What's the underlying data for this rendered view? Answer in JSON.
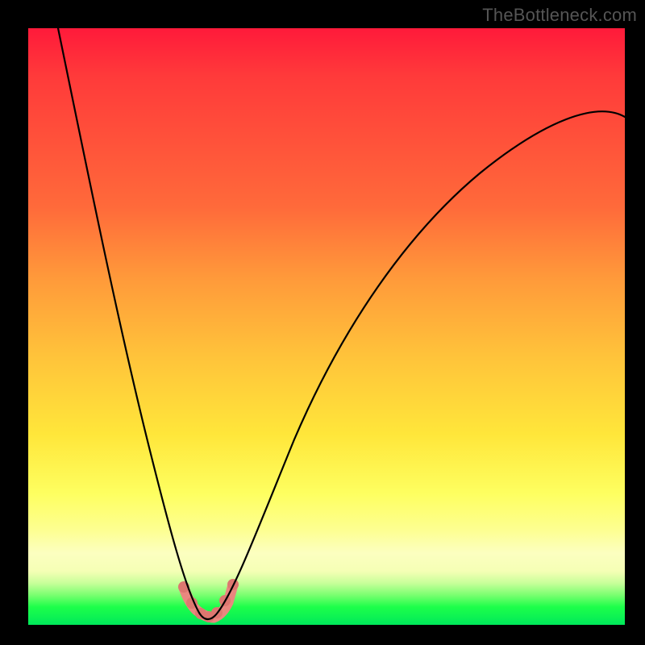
{
  "watermark": "TheBottleneck.com",
  "colors": {
    "frame": "#000000",
    "gradient_top": "#ff1a3a",
    "gradient_mid": "#ffe63a",
    "gradient_bottom": "#00e85a",
    "curve": "#000000",
    "accent": "#e9877f",
    "dot": "#dd7770",
    "watermark": "#555555"
  },
  "chart_data": {
    "type": "line",
    "title": "",
    "xlabel": "",
    "ylabel": "",
    "xlim": [
      0,
      1
    ],
    "ylim": [
      0,
      1
    ],
    "series": [
      {
        "name": "curve",
        "x": [
          0.05,
          0.08,
          0.12,
          0.16,
          0.2,
          0.24,
          0.27,
          0.285,
          0.3,
          0.315,
          0.335,
          0.36,
          0.4,
          0.46,
          0.54,
          0.63,
          0.73,
          0.84,
          0.95,
          1.0
        ],
        "y": [
          1.0,
          0.86,
          0.67,
          0.49,
          0.32,
          0.16,
          0.06,
          0.02,
          0.01,
          0.02,
          0.06,
          0.13,
          0.24,
          0.38,
          0.52,
          0.63,
          0.72,
          0.79,
          0.83,
          0.845
        ]
      }
    ],
    "accent_segment": {
      "name": "accent-u",
      "x": [
        0.262,
        0.274,
        0.286,
        0.3,
        0.314,
        0.328,
        0.342
      ],
      "y": [
        0.06,
        0.035,
        0.018,
        0.012,
        0.018,
        0.038,
        0.07
      ]
    },
    "accent_dots": {
      "x": [
        0.262,
        0.276,
        0.29,
        0.3,
        0.312,
        0.326,
        0.342
      ],
      "y": [
        0.062,
        0.032,
        0.016,
        0.012,
        0.018,
        0.038,
        0.072
      ]
    },
    "minimum": {
      "x": 0.3,
      "y": 0.01
    }
  }
}
